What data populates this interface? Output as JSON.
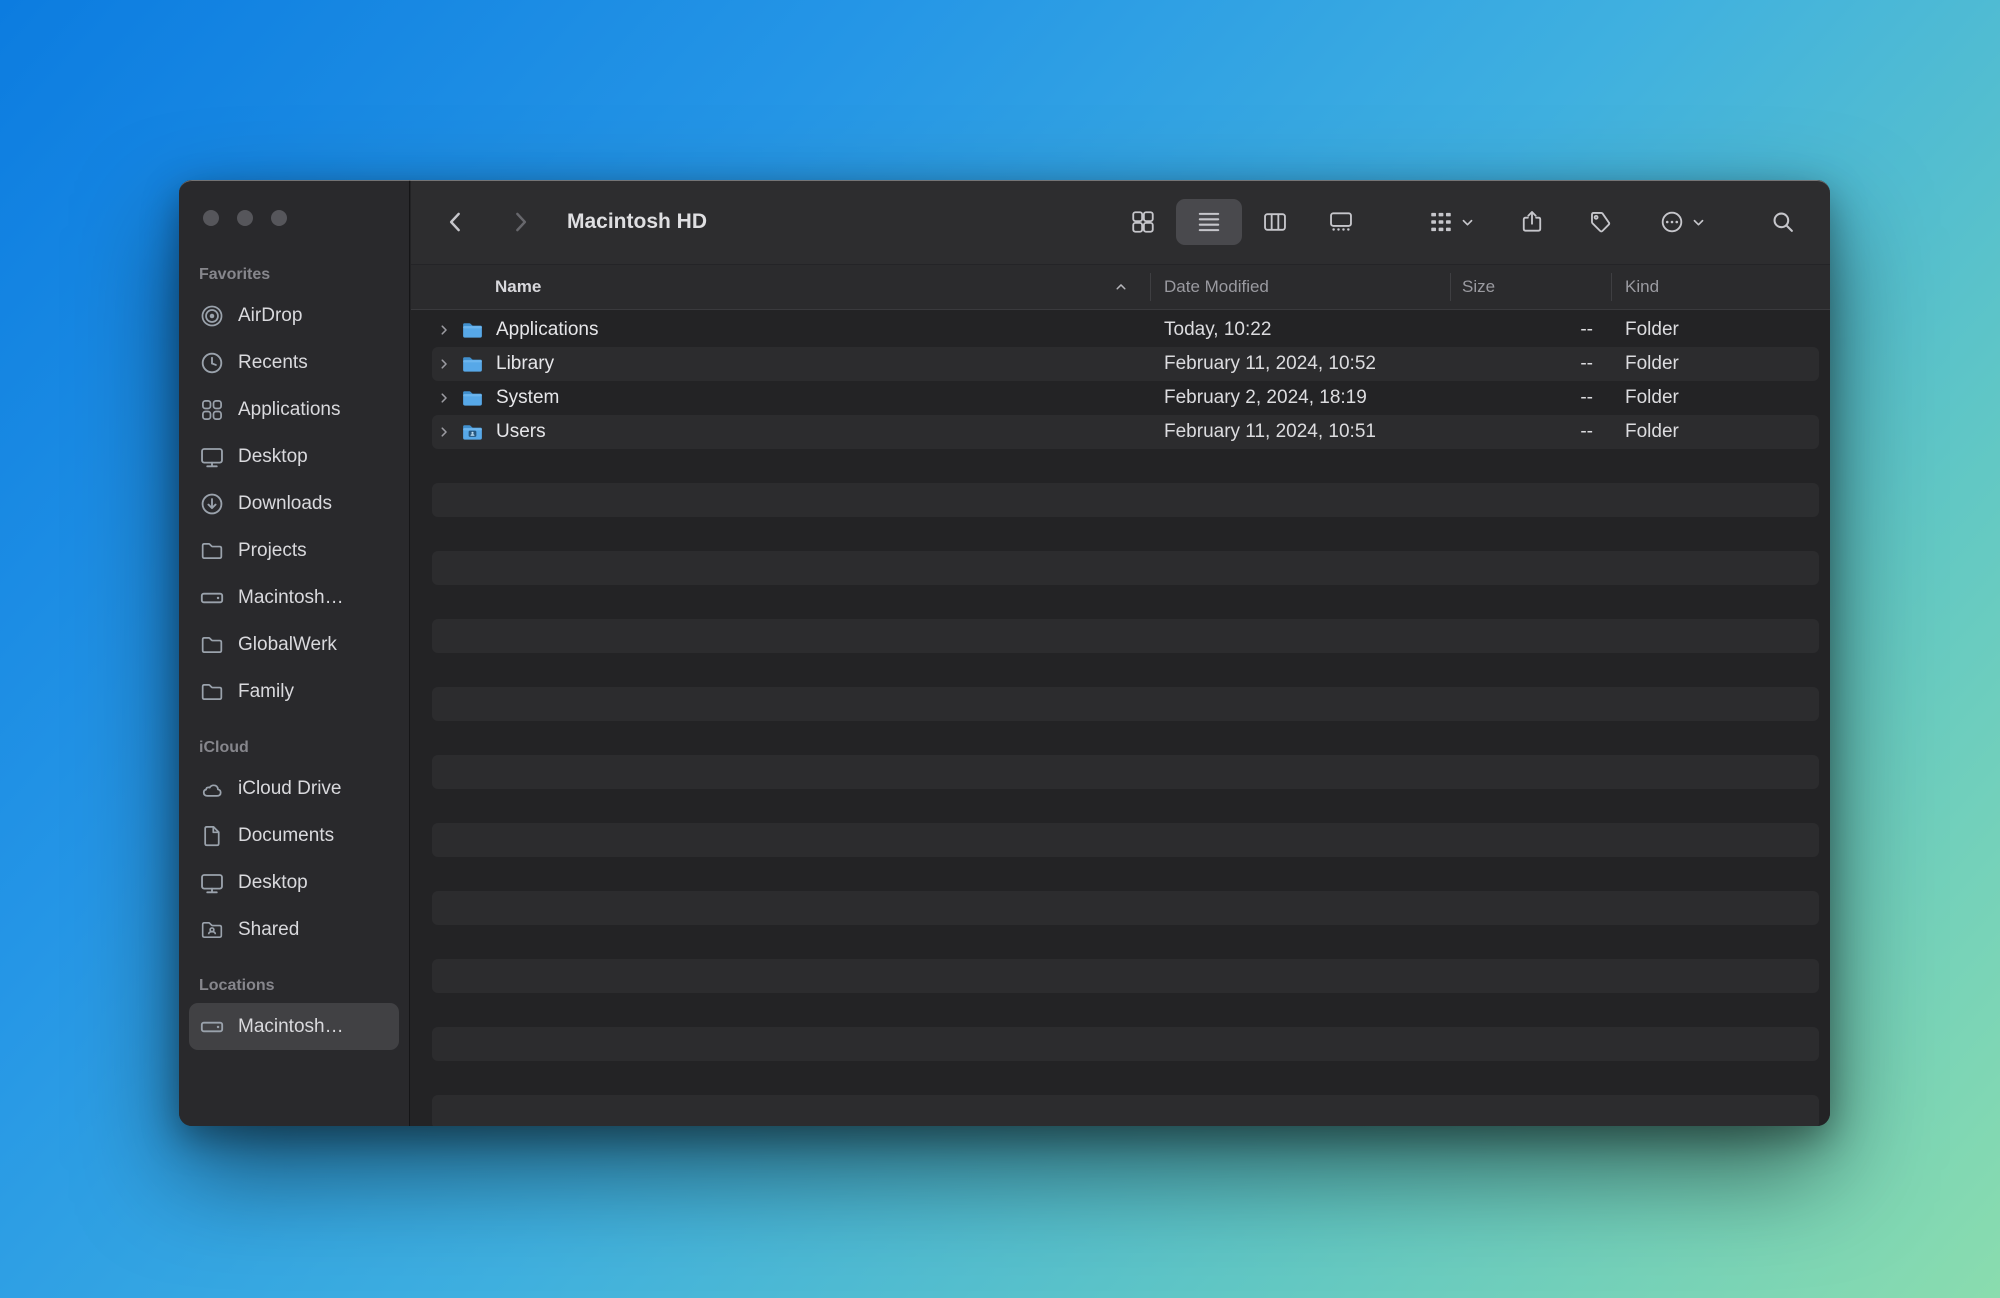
{
  "window": {
    "title": "Macintosh HD"
  },
  "toolbar": {
    "back_enabled": true,
    "forward_enabled": false,
    "selected_view": "list",
    "views": [
      "icon",
      "list",
      "column",
      "gallery"
    ]
  },
  "sidebar": {
    "sections": [
      {
        "label": "Favorites",
        "items": [
          {
            "label": "AirDrop",
            "icon": "airdrop-icon"
          },
          {
            "label": "Recents",
            "icon": "clock-icon"
          },
          {
            "label": "Applications",
            "icon": "app-grid-icon"
          },
          {
            "label": "Desktop",
            "icon": "monitor-icon"
          },
          {
            "label": "Downloads",
            "icon": "download-circle-icon"
          },
          {
            "label": "Projects",
            "icon": "folder-icon"
          },
          {
            "label": "Macintosh…",
            "icon": "hard-drive-icon"
          },
          {
            "label": "GlobalWerk",
            "icon": "folder-icon"
          },
          {
            "label": "Family",
            "icon": "folder-icon"
          }
        ]
      },
      {
        "label": "iCloud",
        "items": [
          {
            "label": "iCloud Drive",
            "icon": "cloud-icon"
          },
          {
            "label": "Documents",
            "icon": "document-icon"
          },
          {
            "label": "Desktop",
            "icon": "monitor-icon"
          },
          {
            "label": "Shared",
            "icon": "shared-folder-icon"
          }
        ]
      },
      {
        "label": "Locations",
        "items": [
          {
            "label": "Macintosh…",
            "icon": "hard-drive-icon",
            "selected": true
          }
        ]
      }
    ]
  },
  "list": {
    "columns": [
      "Name",
      "Date Modified",
      "Size",
      "Kind"
    ],
    "sort": {
      "column": "Name",
      "direction": "ascending"
    },
    "rows": [
      {
        "name": "Applications",
        "date_modified": "Today, 10:22",
        "size": "--",
        "kind": "Folder",
        "icon": "folder-icon"
      },
      {
        "name": "Library",
        "date_modified": "February 11, 2024, 10:52",
        "size": "--",
        "kind": "Folder",
        "icon": "folder-icon"
      },
      {
        "name": "System",
        "date_modified": "February 2, 2024, 18:19",
        "size": "--",
        "kind": "Folder",
        "icon": "folder-icon"
      },
      {
        "name": "Users",
        "date_modified": "February 11, 2024, 10:51",
        "size": "--",
        "kind": "Folder",
        "icon": "folder-users-icon"
      }
    ]
  },
  "colors": {
    "folder_blue": "#57a8e8",
    "desktop_gradient_start": "#0c7ce0",
    "desktop_gradient_end": "#8adcae",
    "window_background": "#232325",
    "sidebar_selected_background": "#414144"
  }
}
